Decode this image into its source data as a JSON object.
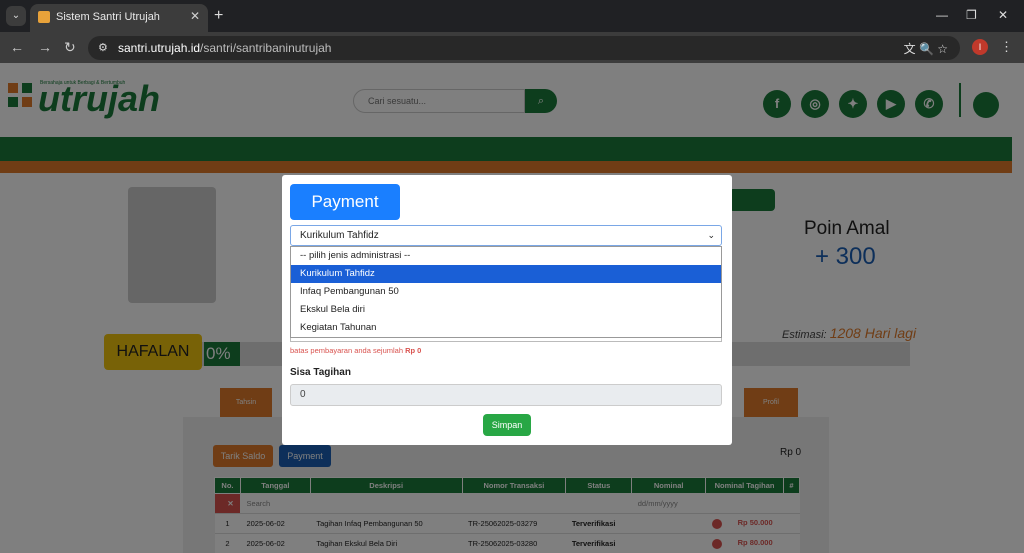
{
  "browser": {
    "tab_title": "Sistem Santri Utrujah",
    "url_host": "santri.utrujah.id",
    "url_path": "/santri/santribaninutrujah",
    "profile_initial": "I"
  },
  "header": {
    "logo_text": "utrujah",
    "logo_tagline": "Bersahaja untuk Berbagi & Bertumbuh",
    "search_placeholder": "Cari sesuatu...",
    "social_icons": [
      "facebook-icon",
      "instagram-icon",
      "twitter-icon",
      "youtube-icon",
      "whatsapp-icon"
    ]
  },
  "profile": {
    "poin_label": "Poin Amal",
    "poin_value": "+ 300",
    "estimasi_label": "Estimasi:",
    "estimasi_value": "1208 Hari lagi",
    "hafalan_label": "HAFALAN",
    "hafalan_percent": "0%",
    "hafalan_progress": 0
  },
  "nav_tabs": [
    "Tahsin",
    "Profil"
  ],
  "content": {
    "chip_tarik_saldo": "Tarik Saldo",
    "chip_payment": "Payment",
    "total": "Rp 0",
    "table": {
      "headers": [
        "No.",
        "Tanggal",
        "Deskripsi",
        "Nomor Transaksi",
        "Status",
        "Nominal",
        "Nominal Tagihan",
        "#"
      ],
      "search_placeholder": "Search",
      "date_placeholder": "dd/mm/yyyy",
      "rows": [
        {
          "no": "1",
          "tanggal": "2025-06-02",
          "deskripsi": "Tagihan Infaq Pembangunan 50",
          "nomor": "TR-25062025-03279",
          "status": "Terverifikasi",
          "tagihan": "Rp 50.000"
        },
        {
          "no": "2",
          "tanggal": "2025-06-02",
          "deskripsi": "Tagihan Ekskul Bela Diri",
          "nomor": "TR-25062025-03280",
          "status": "Terverifikasi",
          "tagihan": "Rp 80.000"
        }
      ]
    }
  },
  "modal": {
    "title": "Payment",
    "selected": "Kurikulum Tahfidz",
    "options": [
      "-- pilih jenis administrasi --",
      "Kurikulum Tahfidz",
      "Infaq Pembangunan 50",
      "Ekskul Bela diri",
      "Kegiatan Tahunan"
    ],
    "selected_index": 1,
    "warning_prefix": "batas pembayaran anda sejumlah",
    "warning_amount": "Rp 0",
    "sisa_label": "Sisa Tagihan",
    "sisa_value": "0",
    "submit_label": "Simpan"
  },
  "colors": {
    "brand_green": "#1a7a3a",
    "brand_orange": "#e07b2a",
    "primary_blue": "#1a7fff",
    "success_green": "#28a745",
    "danger_red": "#d9534f"
  }
}
